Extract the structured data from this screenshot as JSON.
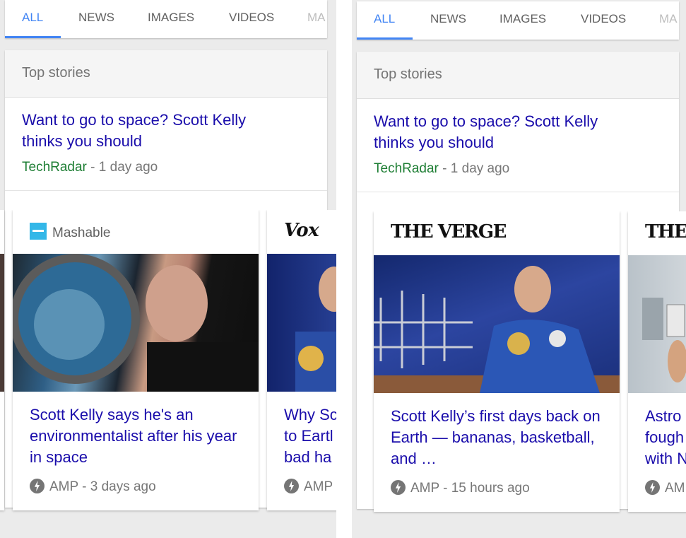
{
  "panels": [
    {
      "tabs": [
        {
          "label": "ALL",
          "active": true
        },
        {
          "label": "NEWS"
        },
        {
          "label": "IMAGES"
        },
        {
          "label": "VIDEOS"
        },
        {
          "label": "MA"
        }
      ],
      "section_title": "Top stories",
      "lead": {
        "title": "Want to go to space? Scott Kelly thinks you should",
        "source": "TechRadar",
        "time": "- 1 day ago"
      },
      "stories": [
        {
          "publisher": "Mashable",
          "image": "scott-kelly-by-iss-window",
          "title": "Scott Kelly says he's an environmentalist after his year in space",
          "amp": "AMP",
          "time": "- 3 days ago"
        },
        {
          "publisher": "Vox",
          "image": "scott-kelly-flight-suit",
          "title": "Why Sc to Eartl bad ha",
          "amp": "AMP"
        }
      ]
    },
    {
      "tabs": [
        {
          "label": "ALL",
          "active": true
        },
        {
          "label": "NEWS"
        },
        {
          "label": "IMAGES"
        },
        {
          "label": "VIDEOS"
        },
        {
          "label": "MA"
        }
      ],
      "section_title": "Top stories",
      "lead": {
        "title": "Want to go to space? Scott Kelly thinks you should",
        "source": "TechRadar",
        "time": "- 1 day ago"
      },
      "stories": [
        {
          "publisher": "THE VERGE",
          "image": "scott-kelly-blue-flight-suit",
          "title": "Scott Kelly’s first days back on Earth — bananas, basketball, and …",
          "amp": "AMP",
          "time": "- 15 hours ago"
        },
        {
          "publisher": "THE V",
          "image": "space-station-interior",
          "title": "Astro fough with N",
          "amp": "AM"
        }
      ]
    }
  ],
  "colors": {
    "accent": "#4285f4",
    "link": "#1a0dab",
    "source_green": "#1e7e34",
    "mashable_blue": "#33b7e8"
  }
}
